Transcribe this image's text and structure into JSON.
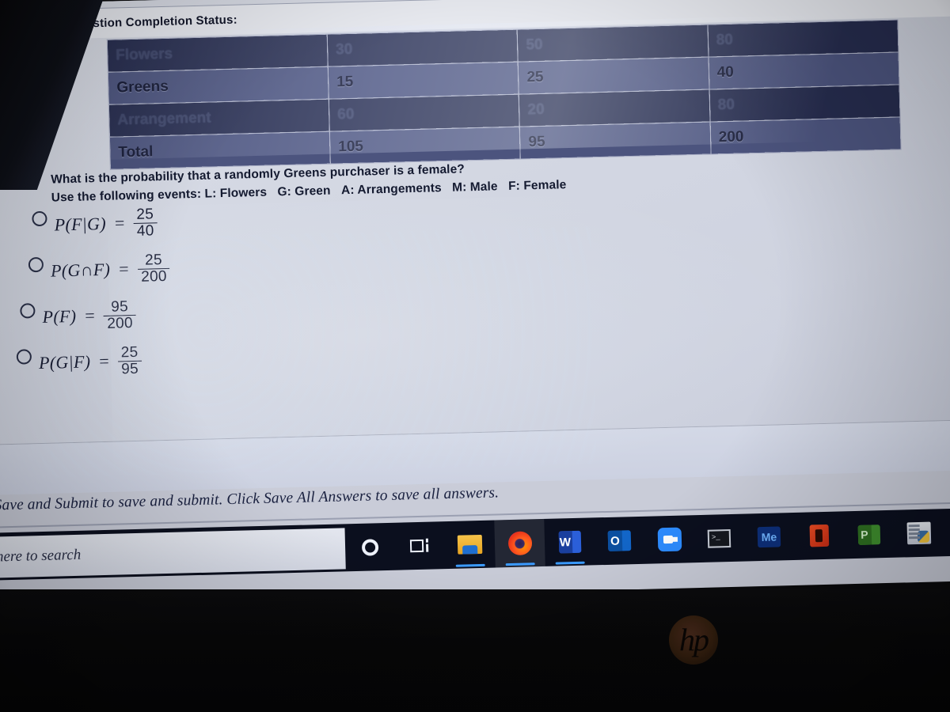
{
  "status_bar": {
    "caret_icon": "chevron-down-icon",
    "label": "Question Completion Status:"
  },
  "table": {
    "rows": [
      {
        "label": "Flowers",
        "cells": [
          "30",
          "50",
          "80"
        ],
        "shade": "dark"
      },
      {
        "label": "Greens",
        "cells": [
          "15",
          "25",
          "40"
        ],
        "shade": "light"
      },
      {
        "label": "Arrangement",
        "cells": [
          "60",
          "20",
          "80"
        ],
        "shade": "dark"
      },
      {
        "label": "Total",
        "cells": [
          "105",
          "95",
          "200"
        ],
        "shade": "light"
      }
    ]
  },
  "question": {
    "prompt": "What is the probability that a randomly Greens purchaser is a female?",
    "events_intro": "Use the following events:",
    "events": [
      {
        "key": "L:",
        "name": "Flowers"
      },
      {
        "key": "G:",
        "name": "Green"
      },
      {
        "key": "A:",
        "name": "Arrangements"
      },
      {
        "key": "M:",
        "name": "Male"
      },
      {
        "key": "F:",
        "name": "Female"
      }
    ]
  },
  "options": [
    {
      "expr": "P(F|G)",
      "eq": "=",
      "numerator": "25",
      "denominator": "40",
      "selected": false
    },
    {
      "expr": "P(G∩F)",
      "eq": "=",
      "numerator": "25",
      "denominator": "200",
      "selected": false
    },
    {
      "expr": "P(F)",
      "eq": "=",
      "numerator": "95",
      "denominator": "200",
      "selected": false
    },
    {
      "expr": "P(G|F)",
      "eq": "=",
      "numerator": "25",
      "denominator": "95",
      "selected": false
    }
  ],
  "footer": {
    "instructions": "Save and Submit to save and submit. Click Save All Answers to save all answers."
  },
  "taskbar": {
    "search_text": "pe here to search",
    "items": [
      {
        "icon": "cortana-icon",
        "running": false
      },
      {
        "icon": "task-view-icon",
        "running": false
      },
      {
        "icon": "file-explorer-icon",
        "running": true
      },
      {
        "icon": "firefox-icon",
        "running": true
      },
      {
        "icon": "word-icon",
        "running": true
      },
      {
        "icon": "outlook-icon",
        "running": false
      },
      {
        "icon": "zoom-icon",
        "running": false
      },
      {
        "icon": "command-prompt-icon",
        "running": false
      },
      {
        "icon": "me-icon",
        "running": false
      },
      {
        "icon": "office-icon",
        "running": false
      },
      {
        "icon": "publisher-icon",
        "running": false
      },
      {
        "icon": "python-ide-icon",
        "running": false
      }
    ]
  },
  "laptop": {
    "brand": "hp"
  }
}
